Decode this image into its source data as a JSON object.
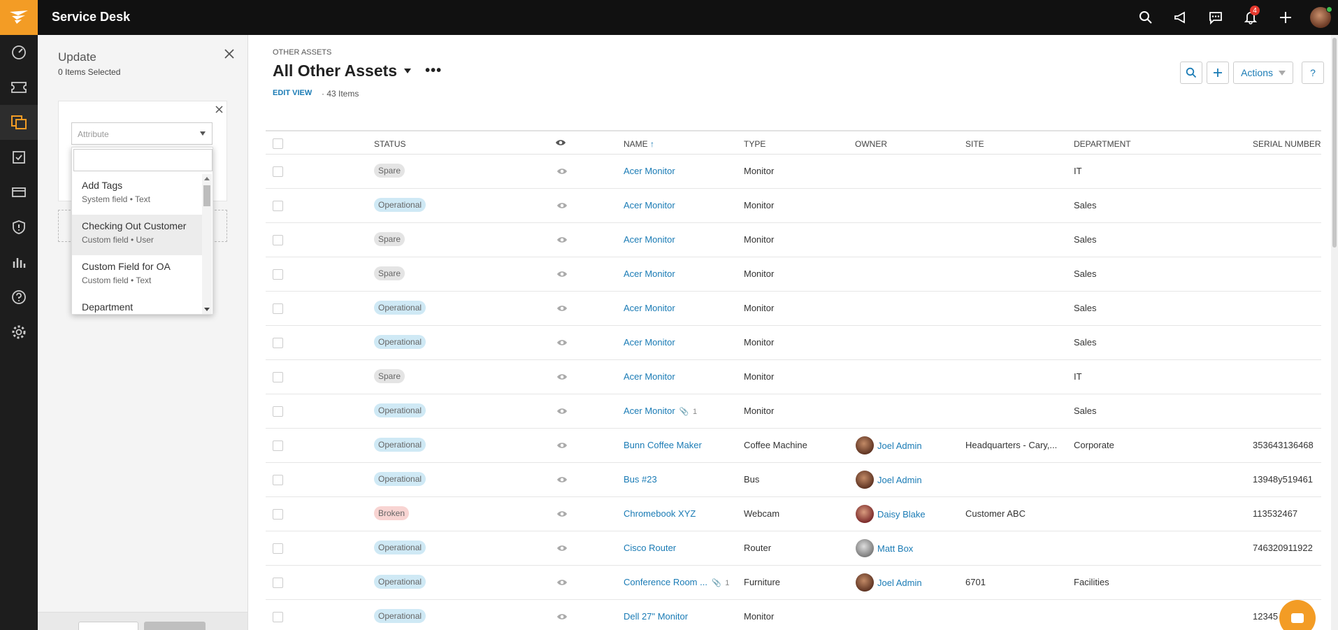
{
  "topbar": {
    "app_title": "Service Desk",
    "notification_count": "4"
  },
  "panel": {
    "title": "Update",
    "subtitle": "0 Items Selected",
    "attribute_placeholder": "Attribute",
    "dropdown_items": [
      {
        "title": "Add Tags",
        "sub": "System field • Text"
      },
      {
        "title": "Checking Out Customer",
        "sub": "Custom field • User"
      },
      {
        "title": "Custom Field for OA",
        "sub": "Custom field • Text"
      },
      {
        "title": "Department",
        "sub": ""
      }
    ]
  },
  "main": {
    "breadcrumb": "OTHER ASSETS",
    "title": "All Other Assets",
    "edit_view": "EDIT VIEW",
    "item_count": "· 43 Items",
    "actions_label": "Actions",
    "help_label": "?"
  },
  "table": {
    "headers": {
      "status": "STATUS",
      "name": "NAME",
      "type": "TYPE",
      "owner": "OWNER",
      "site": "SITE",
      "department": "DEPARTMENT",
      "serial": "SERIAL NUMBER"
    },
    "rows": [
      {
        "status": "Spare",
        "name": "Acer Monitor",
        "attach": "",
        "type": "Monitor",
        "owner": "",
        "site": "",
        "department": "IT",
        "serial": ""
      },
      {
        "status": "Operational",
        "name": "Acer Monitor",
        "attach": "",
        "type": "Monitor",
        "owner": "",
        "site": "",
        "department": "Sales",
        "serial": ""
      },
      {
        "status": "Spare",
        "name": "Acer Monitor",
        "attach": "",
        "type": "Monitor",
        "owner": "",
        "site": "",
        "department": "Sales",
        "serial": ""
      },
      {
        "status": "Spare",
        "name": "Acer Monitor",
        "attach": "",
        "type": "Monitor",
        "owner": "",
        "site": "",
        "department": "Sales",
        "serial": ""
      },
      {
        "status": "Operational",
        "name": "Acer Monitor",
        "attach": "",
        "type": "Monitor",
        "owner": "",
        "site": "",
        "department": "Sales",
        "serial": ""
      },
      {
        "status": "Operational",
        "name": "Acer Monitor",
        "attach": "",
        "type": "Monitor",
        "owner": "",
        "site": "",
        "department": "Sales",
        "serial": ""
      },
      {
        "status": "Spare",
        "name": "Acer Monitor",
        "attach": "",
        "type": "Monitor",
        "owner": "",
        "site": "",
        "department": "IT",
        "serial": ""
      },
      {
        "status": "Operational",
        "name": "Acer Monitor",
        "attach": "1",
        "type": "Monitor",
        "owner": "",
        "site": "",
        "department": "Sales",
        "serial": ""
      },
      {
        "status": "Operational",
        "name": "Bunn Coffee Maker",
        "attach": "",
        "type": "Coffee Machine",
        "owner": "Joel Admin",
        "site": "Headquarters - Cary,...",
        "department": "Corporate",
        "serial": "353643136468"
      },
      {
        "status": "Operational",
        "name": "Bus #23",
        "attach": "",
        "type": "Bus",
        "owner": "Joel Admin",
        "site": "",
        "department": "",
        "serial": "13948y519461"
      },
      {
        "status": "Broken",
        "name": "Chromebook XYZ",
        "attach": "",
        "type": "Webcam",
        "owner": "Daisy Blake",
        "site": "Customer ABC",
        "department": "",
        "serial": "113532467"
      },
      {
        "status": "Operational",
        "name": "Cisco Router",
        "attach": "",
        "type": "Router",
        "owner": "Matt Box",
        "site": "",
        "department": "",
        "serial": "746320911922"
      },
      {
        "status": "Operational",
        "name": "Conference Room ...",
        "attach": "1",
        "type": "Furniture",
        "owner": "Joel Admin",
        "site": "6701",
        "department": "Facilities",
        "serial": ""
      },
      {
        "status": "Operational",
        "name": "Dell 27\" Monitor",
        "attach": "",
        "type": "Monitor",
        "owner": "",
        "site": "",
        "department": "",
        "serial": "12345"
      }
    ]
  },
  "icons": {
    "logo": "solarwinds-logo-icon",
    "search": "search-icon",
    "announce": "megaphone-icon",
    "chat": "chat-icon",
    "bell": "bell-icon",
    "add": "plus-icon"
  },
  "colors": {
    "accent": "#f39c25",
    "link": "#1a7bb5",
    "topbar": "#111111"
  }
}
